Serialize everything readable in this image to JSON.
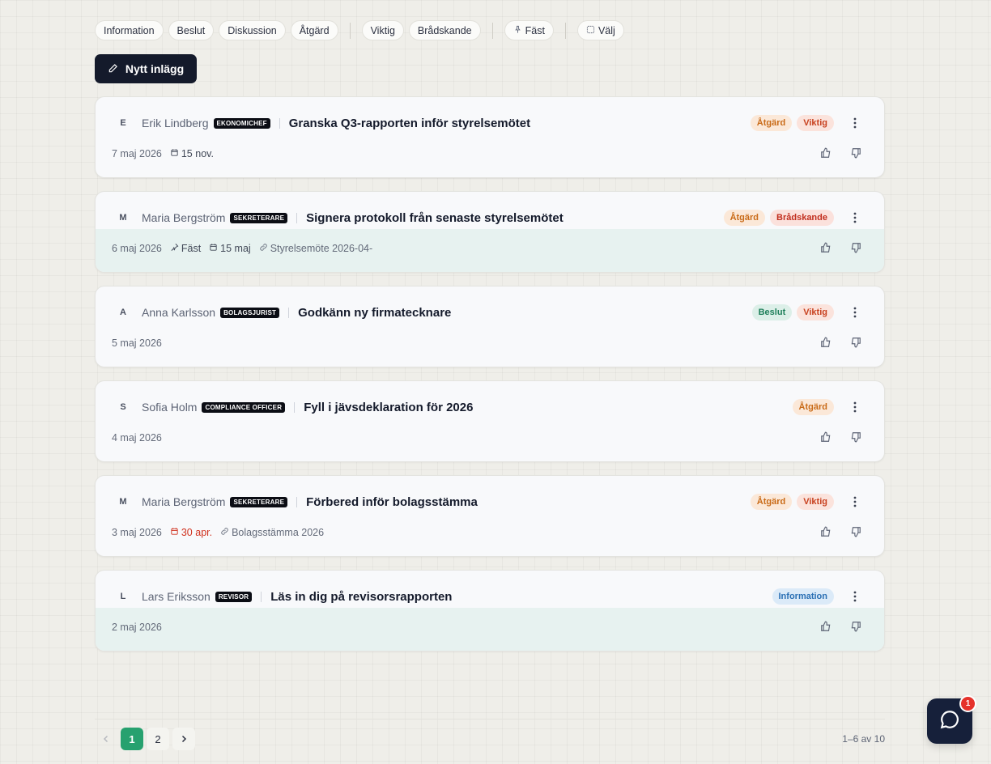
{
  "filters": {
    "categories": [
      "Information",
      "Beslut",
      "Diskussion",
      "Åtgärd"
    ],
    "priorities": [
      "Viktig",
      "Brådskande"
    ],
    "pinned": "Fäst",
    "select": "Välj"
  },
  "new_post_label": "Nytt inlägg",
  "posts": [
    {
      "avatar": "E",
      "author": "Erik Lindberg",
      "role": "EKONOMICHEF",
      "title": "Granska Q3-rapporten inför styrelsemötet",
      "tags": [
        "Åtgärd",
        "Viktig"
      ],
      "date": "7 maj 2026",
      "due": "15 nov."
    },
    {
      "avatar": "M",
      "author": "Maria Bergström",
      "role": "SEKRETERARE",
      "title": "Signera protokoll från senaste styrelsemötet",
      "tags": [
        "Åtgärd",
        "Brådskande"
      ],
      "date": "6 maj 2026",
      "pinned": "Fäst",
      "due": "15 maj",
      "link": "Styrelsemöte 2026-04-"
    },
    {
      "avatar": "A",
      "author": "Anna Karlsson",
      "role": "BOLAGSJURIST",
      "title": "Godkänn ny firmatecknare",
      "tags": [
        "Beslut",
        "Viktig"
      ],
      "date": "5 maj 2026"
    },
    {
      "avatar": "S",
      "author": "Sofia Holm",
      "role": "COMPLIANCE OFFICER",
      "title": "Fyll i jävsdeklaration för 2026",
      "tags": [
        "Åtgärd"
      ],
      "date": "4 maj 2026"
    },
    {
      "avatar": "M",
      "author": "Maria Bergström",
      "role": "SEKRETERARE",
      "title": "Förbered inför bolagsstämma",
      "tags": [
        "Åtgärd",
        "Viktig"
      ],
      "date": "3 maj 2026",
      "due": "30 apr.",
      "link": "Bolagsstämma 2026"
    },
    {
      "avatar": "L",
      "author": "Lars Eriksson",
      "role": "REVISOR",
      "title": "Läs in dig på revisorsrapporten",
      "tags": [
        "Information"
      ],
      "date": "2 maj 2026"
    }
  ],
  "pagination": {
    "pages": [
      "1",
      "2"
    ],
    "current": "1",
    "range": "1–6 av 10"
  },
  "chat": {
    "badge": "1"
  },
  "colors": {
    "primary_dark": "#141a2b",
    "accent_green": "#27a16f",
    "danger": "#e5322b",
    "highlight_row": "#e7f2f0"
  }
}
